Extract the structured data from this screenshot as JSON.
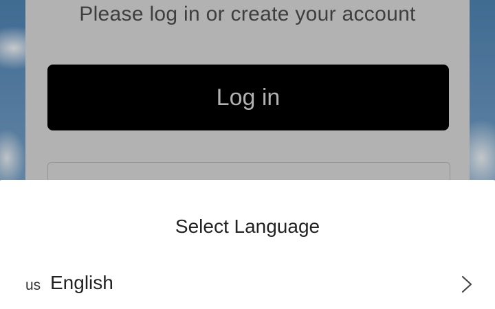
{
  "login_card": {
    "subtitle": "Please log in or create your account",
    "login_button_label": "Log in"
  },
  "language_sheet": {
    "title": "Select Language",
    "items": [
      {
        "code": "us",
        "label": "English",
        "icon": "chevron-right-icon"
      }
    ]
  },
  "colors": {
    "login_button_bg": "#000000",
    "card_bg": "#d9d9d9",
    "sheet_bg": "#ffffff"
  }
}
